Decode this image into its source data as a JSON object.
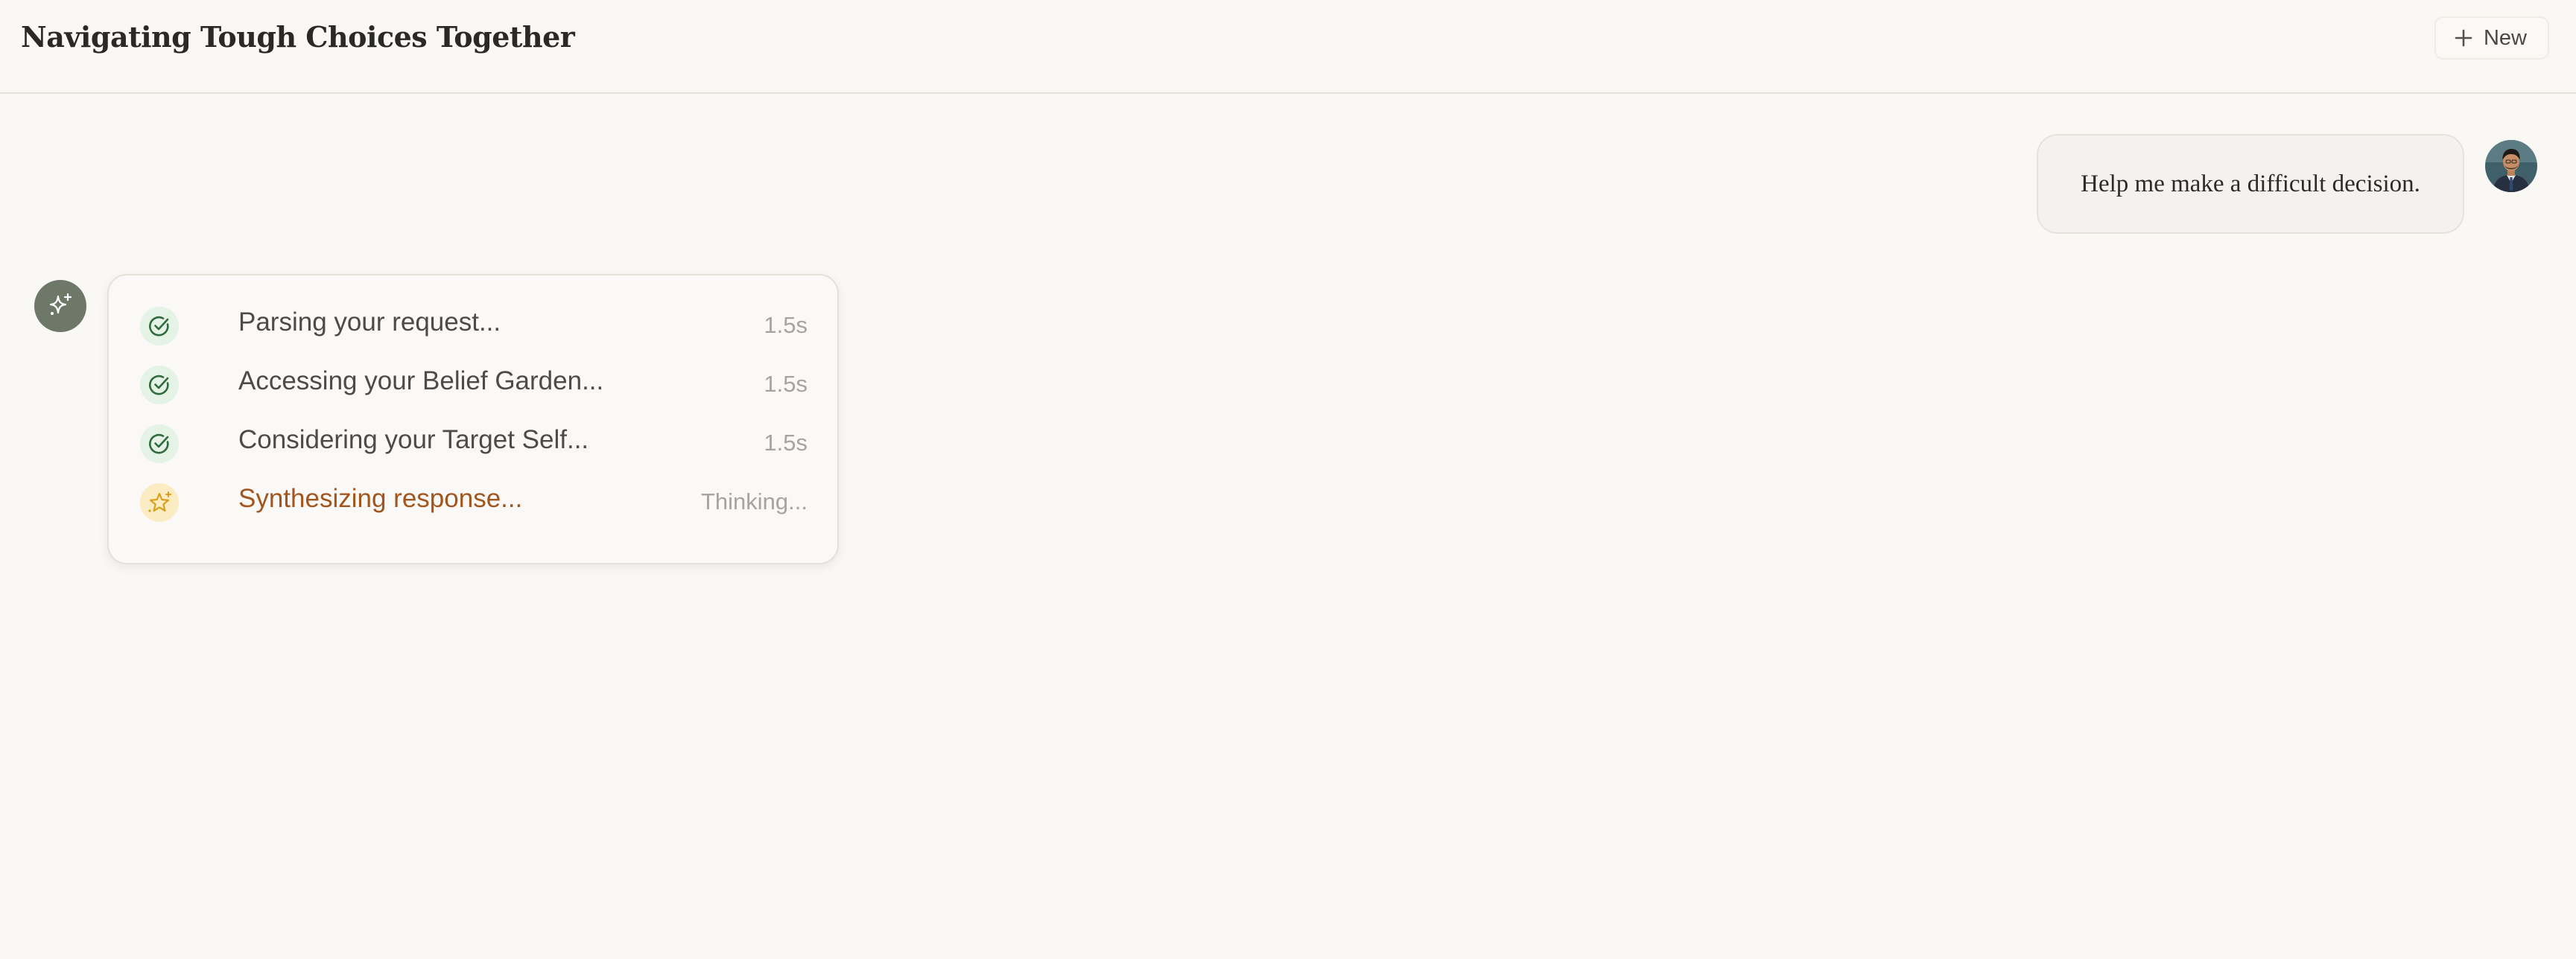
{
  "header": {
    "title": "Navigating Tough Choices Together",
    "new_button": {
      "label": "New",
      "icon": "plus-icon"
    }
  },
  "conversation": {
    "user_message": {
      "text": "Help me make a difficult decision.",
      "avatar": "user-avatar-photo"
    },
    "assistant": {
      "avatar_icon": "sparkles-icon",
      "steps": [
        {
          "label": "Parsing your request...",
          "time": "1.5s",
          "status": "done",
          "icon": "check-circle-icon"
        },
        {
          "label": "Accessing your Belief Garden...",
          "time": "1.5s",
          "status": "done",
          "icon": "check-circle-icon"
        },
        {
          "label": "Considering your Target Self...",
          "time": "1.5s",
          "status": "done",
          "icon": "check-circle-icon"
        },
        {
          "label": "Synthesizing response...",
          "time": "Thinking...",
          "status": "active",
          "icon": "sparkle-star-icon"
        }
      ]
    }
  },
  "colors": {
    "background": "#f9f8f5",
    "assistant_avatar": "#6d7869",
    "done_icon_bg": "#e4f3e6",
    "done_icon_stroke": "#2f6b3c",
    "active_icon_bg": "#fcecc4",
    "active_icon_stroke": "#d9a01a",
    "active_label": "#a2551c"
  }
}
